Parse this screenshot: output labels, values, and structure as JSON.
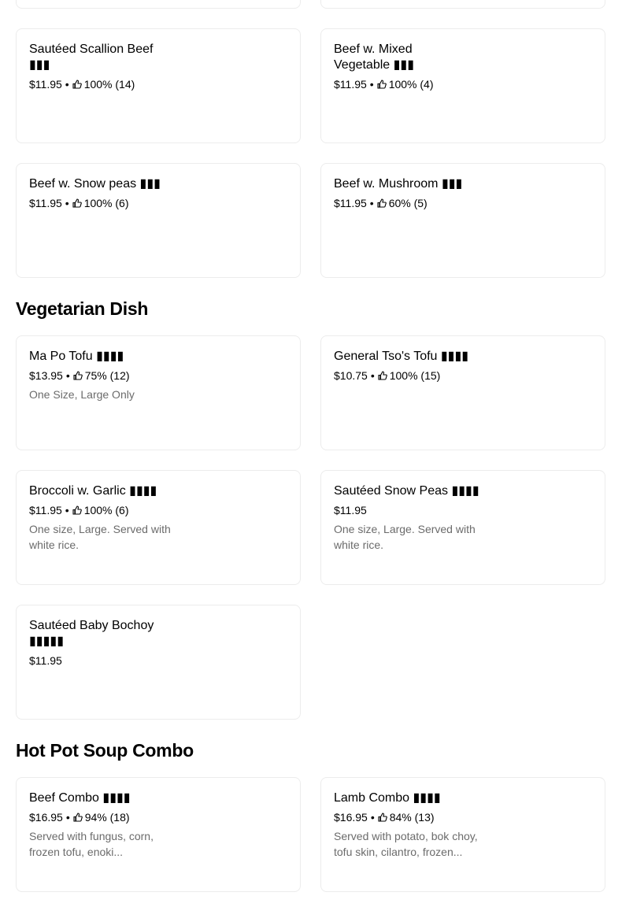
{
  "sections": {
    "vegetarian": "Vegetarian Dish",
    "hotpot": "Hot Pot Soup Combo"
  },
  "items": [
    {
      "name": "Sautéed Scallion Beef ▮▮▮",
      "price": "$11.95",
      "rating": "100% (14)",
      "desc": ""
    },
    {
      "name": "Beef w. Mixed Vegetable ▮▮▮",
      "price": "$11.95",
      "rating": "100% (4)",
      "desc": ""
    },
    {
      "name": "Beef w. Snow peas ▮▮▮",
      "price": "$11.95",
      "rating": "100% (6)",
      "desc": ""
    },
    {
      "name": "Beef w. Mushroom ▮▮▮",
      "price": "$11.95",
      "rating": "60% (5)",
      "desc": ""
    },
    {
      "name": "Ma Po Tofu ▮▮▮▮",
      "price": "$13.95",
      "rating": "75% (12)",
      "desc": "One Size, Large Only"
    },
    {
      "name": "General Tso's Tofu ▮▮▮▮",
      "price": "$10.75",
      "rating": "100% (15)",
      "desc": ""
    },
    {
      "name": "Broccoli w. Garlic ▮▮▮▮",
      "price": "$11.95",
      "rating": "100% (6)",
      "desc": "One size, Large. Served with white rice."
    },
    {
      "name": "Sautéed Snow Peas ▮▮▮▮",
      "price": "$11.95",
      "rating": "",
      "desc": "One size, Large. Served with white rice."
    },
    {
      "name": "Sautéed Baby Bochoy ▮▮▮▮▮",
      "price": "$11.95",
      "rating": "",
      "desc": ""
    },
    {
      "name": "Beef Combo ▮▮▮▮",
      "price": "$16.95",
      "rating": "94% (18)",
      "desc": "Served with fungus, corn, frozen tofu, enoki..."
    },
    {
      "name": "Lamb Combo ▮▮▮▮",
      "price": "$16.95",
      "rating": "84% (13)",
      "desc": "Served with potato, bok choy, tofu skin, cilantro, frozen..."
    }
  ],
  "separator": "•",
  "icon": "thumbs-up-icon"
}
